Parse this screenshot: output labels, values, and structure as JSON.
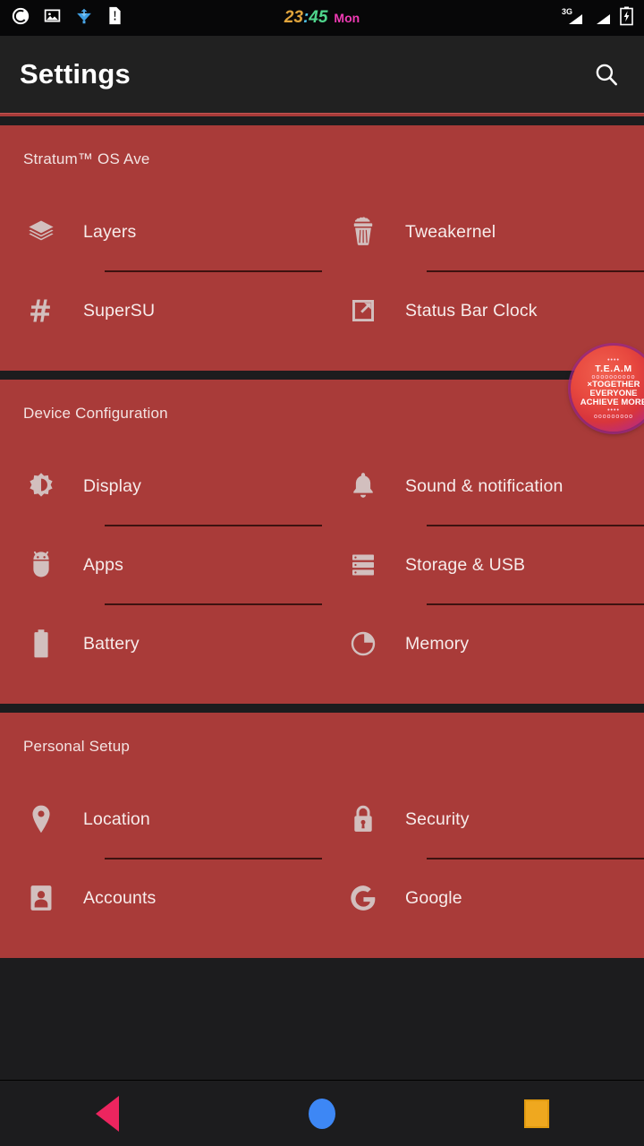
{
  "status_bar": {
    "left_icons": [
      {
        "name": "media-play-icon"
      },
      {
        "name": "photo-image-icon"
      },
      {
        "name": "download-icon"
      },
      {
        "name": "document-alert-icon"
      }
    ],
    "clock": {
      "hours": "23",
      "separator": ":",
      "minutes": "45",
      "day": "Mon"
    },
    "right_icons": [
      {
        "name": "signal-3g-icon",
        "label": "3G"
      },
      {
        "name": "signal-bars-icon",
        "label": ""
      },
      {
        "name": "battery-charging-icon",
        "label": ""
      }
    ]
  },
  "app_bar": {
    "title": "Settings",
    "search_icon": "search-icon"
  },
  "badge": {
    "dots_top": "••••",
    "title": "T.E.A.M",
    "dots_mid": "oooooooooo",
    "line1": "×TOGETHER",
    "line2": "EVERYONE",
    "line3": "ACHIEVE MORE",
    "dots_bot": "••••",
    "dots_bot2": "ooooooooo"
  },
  "sections": [
    {
      "header": "Stratum™ OS Ave",
      "rows": [
        {
          "label": "Layers",
          "icon": "layers-icon"
        },
        {
          "label": "Tweakernel",
          "icon": "cupcake-icon"
        },
        {
          "label": "SuperSU",
          "icon": "hash-icon"
        },
        {
          "label": "Status Bar Clock",
          "icon": "external-link-icon"
        }
      ]
    },
    {
      "header": "Device Configuration",
      "rows": [
        {
          "label": "Display",
          "icon": "brightness-icon"
        },
        {
          "label": "Sound & notification",
          "icon": "bell-icon"
        },
        {
          "label": "Apps",
          "icon": "android-bug-icon"
        },
        {
          "label": "Storage & USB",
          "icon": "storage-icon"
        },
        {
          "label": "Battery",
          "icon": "battery-icon"
        },
        {
          "label": "Memory",
          "icon": "pie-chart-icon"
        }
      ]
    },
    {
      "header": "Personal Setup",
      "rows": [
        {
          "label": "Location",
          "icon": "map-pin-icon"
        },
        {
          "label": "Security",
          "icon": "lock-icon"
        },
        {
          "label": "Accounts",
          "icon": "person-card-icon"
        },
        {
          "label": "Google",
          "icon": "google-g-icon"
        }
      ]
    }
  ],
  "nav_bar": {
    "back": "back-triangle",
    "home": "home-circle",
    "recents": "recents-square"
  },
  "colors": {
    "card_red": "#a93b39",
    "status_bar": "#070708",
    "app_bar": "#212121",
    "nav_bar": "#1c1c1e",
    "divider": "#3d1210",
    "nav_back": "#ec255f",
    "nav_home": "#3d87f5",
    "nav_recents": "#efa81f"
  }
}
